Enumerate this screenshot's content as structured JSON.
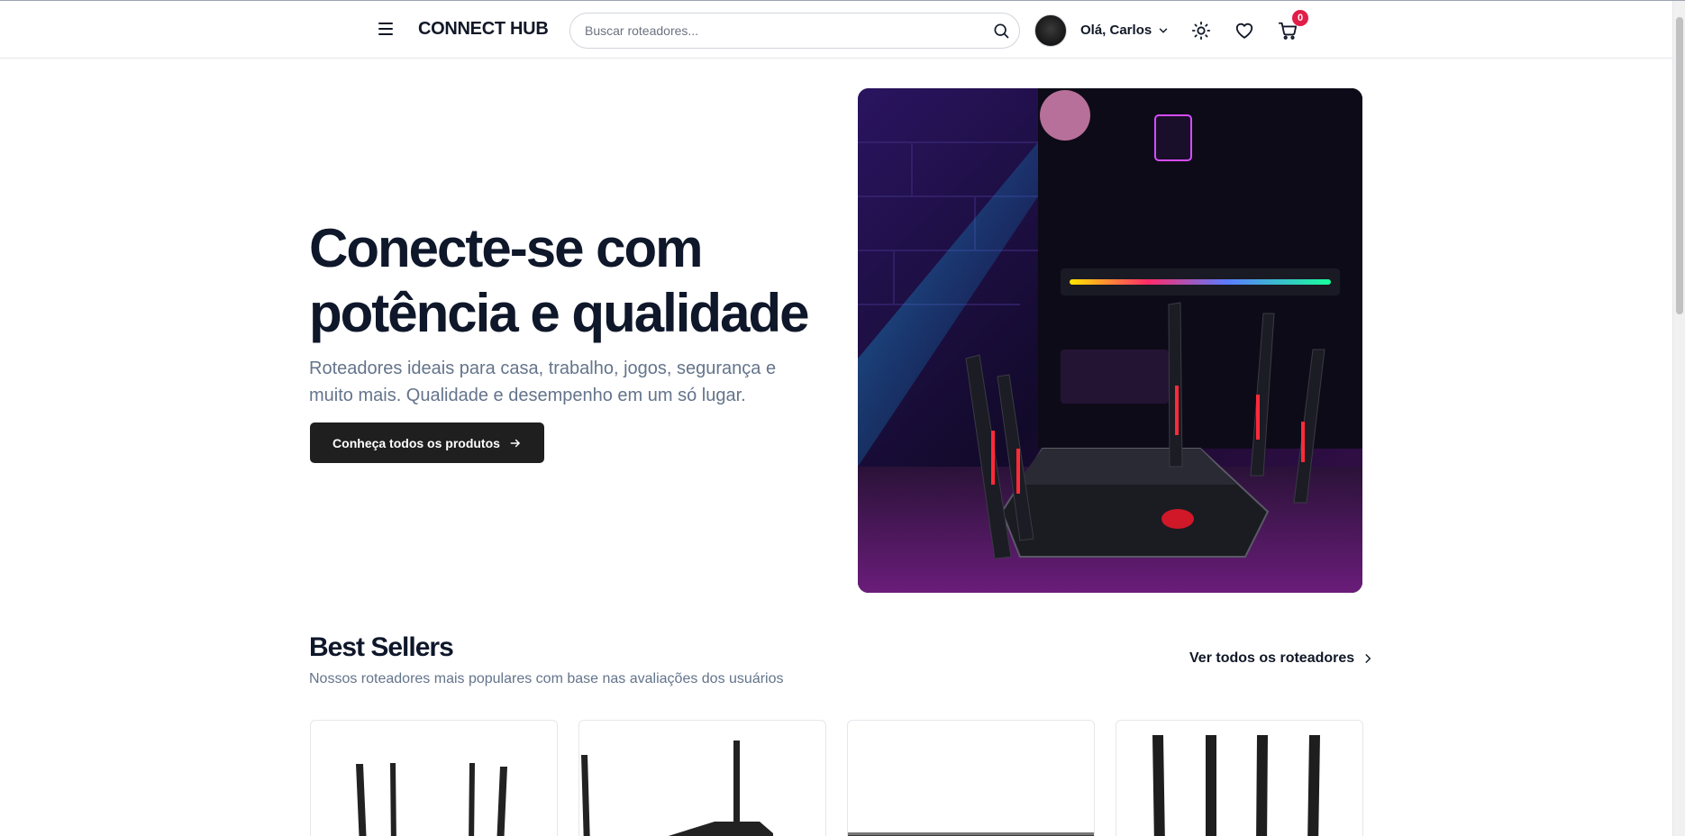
{
  "header": {
    "logo": "CONNECT HUB",
    "search_placeholder": "Buscar roteadores...",
    "greeting": "Olá, Carlos",
    "cart_count": "0",
    "icons": [
      "menu-icon",
      "search-icon",
      "chevron-down-icon",
      "sun-icon",
      "heart-icon",
      "cart-icon"
    ]
  },
  "hero": {
    "title": "Conecte-se com potência e qualidade",
    "subtitle": "Roteadores ideais para casa, trabalho, jogos, segurança e muito mais. Qualidade e desempenho em um só lugar.",
    "cta_label": "Conheça todos os produtos"
  },
  "best_sellers": {
    "title": "Best Sellers",
    "subtitle": "Nossos roteadores mais populares com base nas avaliações dos usuários",
    "link_label": "Ver todos os roteadores"
  },
  "colors": {
    "accent": "#1f1f1f",
    "badge": "#e11d48",
    "muted_text": "#64748b"
  }
}
